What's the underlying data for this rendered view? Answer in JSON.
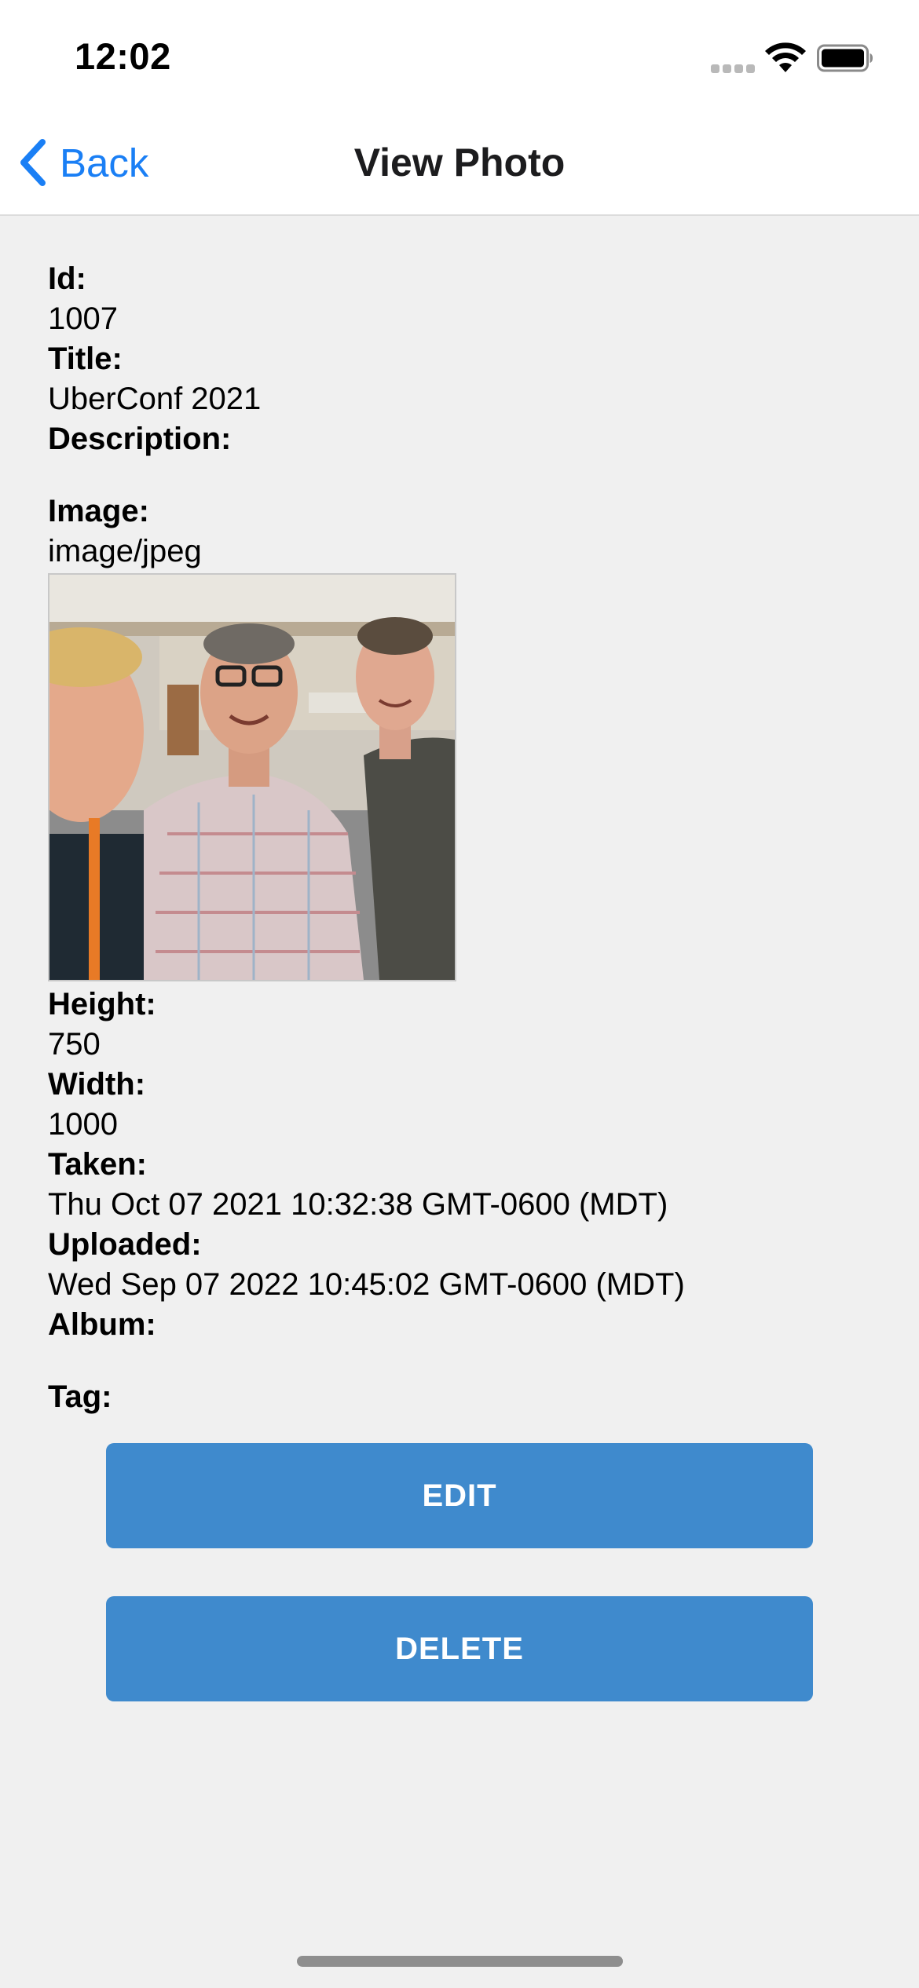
{
  "status_bar": {
    "time": "12:02"
  },
  "nav": {
    "back_label": "Back",
    "title": "View Photo"
  },
  "fields": {
    "id_label": "Id:",
    "id_value": "1007",
    "title_label": "Title:",
    "title_value": "UberConf 2021",
    "description_label": "Description:",
    "description_value": "",
    "image_label": "Image:",
    "image_value": "image/jpeg",
    "height_label": "Height:",
    "height_value": "750",
    "width_label": "Width:",
    "width_value": "1000",
    "taken_label": "Taken:",
    "taken_value": "Thu Oct 07 2021 10:32:38 GMT-0600 (MDT)",
    "uploaded_label": "Uploaded:",
    "uploaded_value": "Wed Sep 07 2022 10:45:02 GMT-0600 (MDT)",
    "album_label": "Album:",
    "album_value": "",
    "tag_label": "Tag:"
  },
  "buttons": {
    "edit_label": "EDIT",
    "delete_label": "DELETE"
  },
  "colors": {
    "accent": "#1a7ff5",
    "button": "#3f8acd",
    "background": "#f0f0f0"
  }
}
